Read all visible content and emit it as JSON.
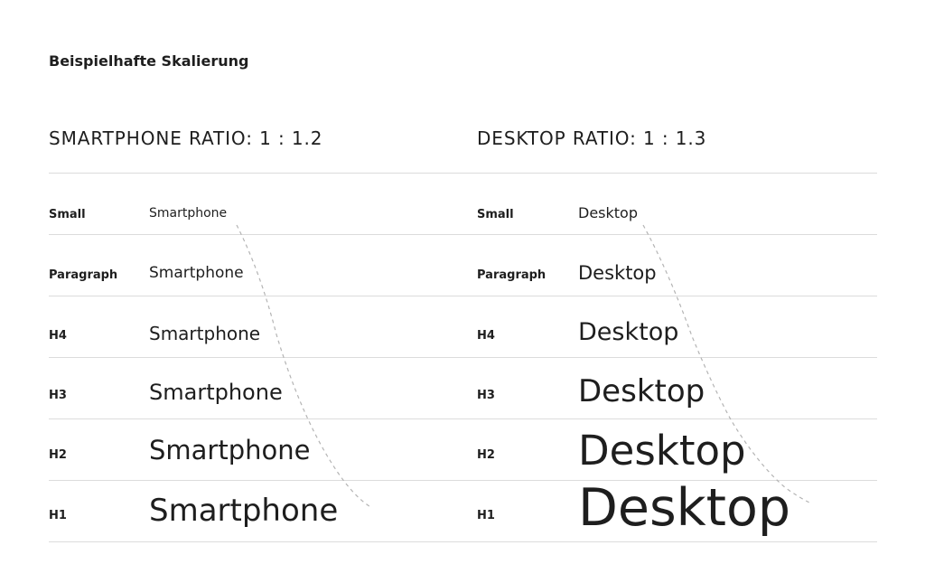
{
  "title": "Beispielhafte Skalierung",
  "smartphone": {
    "heading": "SMARTPHONE RATIO: 1 : 1.2",
    "ratio": 1.2,
    "rows": [
      {
        "label": "Small",
        "sample": "Smartphone"
      },
      {
        "label": "Paragraph",
        "sample": "Smartphone"
      },
      {
        "label": "H4",
        "sample": "Smartphone"
      },
      {
        "label": "H3",
        "sample": "Smartphone"
      },
      {
        "label": "H2",
        "sample": "Smartphone"
      },
      {
        "label": "H1",
        "sample": "Smartphone"
      }
    ]
  },
  "desktop": {
    "heading": "DESKTOP RATIO: 1 : 1.3",
    "ratio": 1.3,
    "rows": [
      {
        "label": "Small",
        "sample": "Desktop"
      },
      {
        "label": "Paragraph",
        "sample": "Desktop"
      },
      {
        "label": "H4",
        "sample": "Desktop"
      },
      {
        "label": "H3",
        "sample": "Desktop"
      },
      {
        "label": "H2",
        "sample": "Desktop"
      },
      {
        "label": "H1",
        "sample": "Desktop"
      }
    ]
  },
  "colors": {
    "text": "#1e1e1e",
    "rule": "#dcdcdc",
    "guide": "#b4b4b4"
  }
}
